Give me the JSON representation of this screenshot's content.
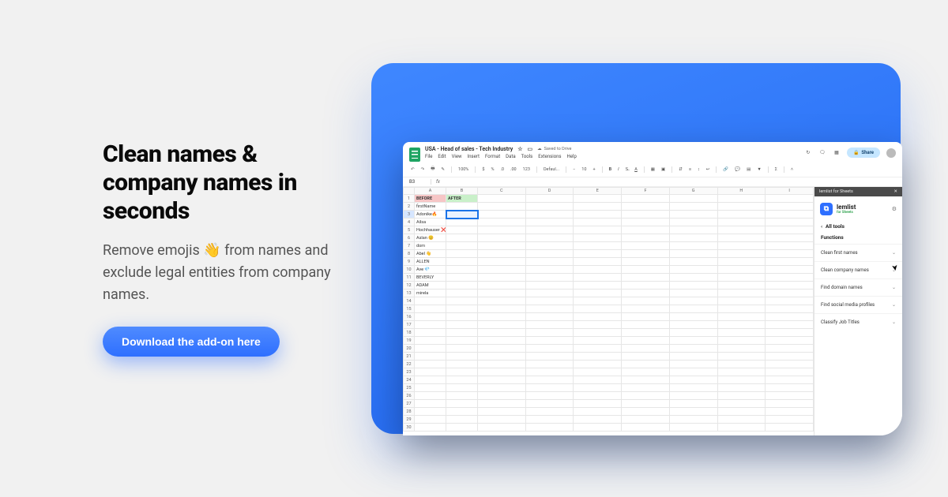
{
  "hero": {
    "heading": "Clean names & company names in seconds",
    "subheading": "Remove emojis 👋 from names and exclude legal entities from company names.",
    "cta_label": "Download the add-on here"
  },
  "sheets": {
    "doc_title": "USA - Head of sales - Tech Industry",
    "saved_status": "Saved to Drive",
    "menu_items": [
      "File",
      "Edit",
      "View",
      "Insert",
      "Format",
      "Data",
      "Tools",
      "Extensions",
      "Help"
    ],
    "share_label": "Share",
    "toolbar": {
      "zoom": "100%",
      "currency": "$",
      "percent": "%",
      "dec_dec": ".0",
      "dec_inc": ".00",
      "number_format": "123",
      "font": "Defaul..."
    },
    "cell_ref": "B3",
    "columns": [
      "A",
      "B",
      "C",
      "D",
      "E",
      "F",
      "G",
      "H",
      "I"
    ],
    "header_row": {
      "before": "BEFORE",
      "after": "AFTER"
    },
    "rows": [
      "firstName",
      "Adonike🔥",
      "Ailsa",
      "Hochhauser ❌",
      "Aslan 😊",
      "dom",
      "Abel 👋",
      "ALLEN",
      "Ave 💎",
      "BEVERLY",
      "ADAM",
      "mirela"
    ]
  },
  "side_panel": {
    "titlebar": "lemlist for Sheets",
    "brand_name": "lemlist",
    "brand_sub": "for Sheets",
    "back_label": "All tools",
    "section_title": "Functions",
    "functions": [
      "Clean first names",
      "Clean company names",
      "Find domain names",
      "Find social media profiles",
      "Classify Job Titles"
    ]
  }
}
